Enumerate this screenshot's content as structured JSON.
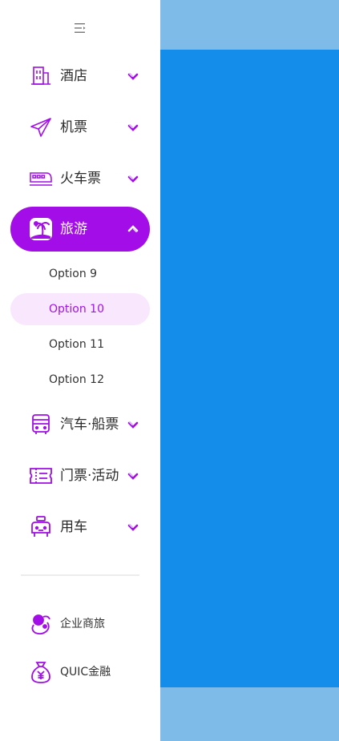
{
  "menu": {
    "items": [
      {
        "label": "酒店",
        "icon": "hotel-icon"
      },
      {
        "label": "机票",
        "icon": "paper-plane-icon"
      },
      {
        "label": "火车票",
        "icon": "train-icon"
      },
      {
        "label": "旅游",
        "icon": "beach-icon",
        "expanded": true
      }
    ],
    "submenu": [
      {
        "label": "Option 9"
      },
      {
        "label": "Option 10",
        "selected": true
      },
      {
        "label": "Option 11"
      },
      {
        "label": "Option 12"
      }
    ],
    "items_after": [
      {
        "label": "汽车·船票",
        "icon": "bus-icon"
      },
      {
        "label": "门票·活动",
        "icon": "ticket-icon"
      },
      {
        "label": "用车",
        "icon": "car-icon"
      }
    ],
    "bottom": [
      {
        "label": "企业商旅",
        "icon": "business-travel-icon"
      },
      {
        "label": "QUIC金融",
        "icon": "money-bag-icon"
      }
    ]
  },
  "colors": {
    "accent": "#a20de8",
    "selected_bg": "#f8e7fd",
    "content_bg": "#138de9",
    "content_band": "#7ebbe9"
  }
}
